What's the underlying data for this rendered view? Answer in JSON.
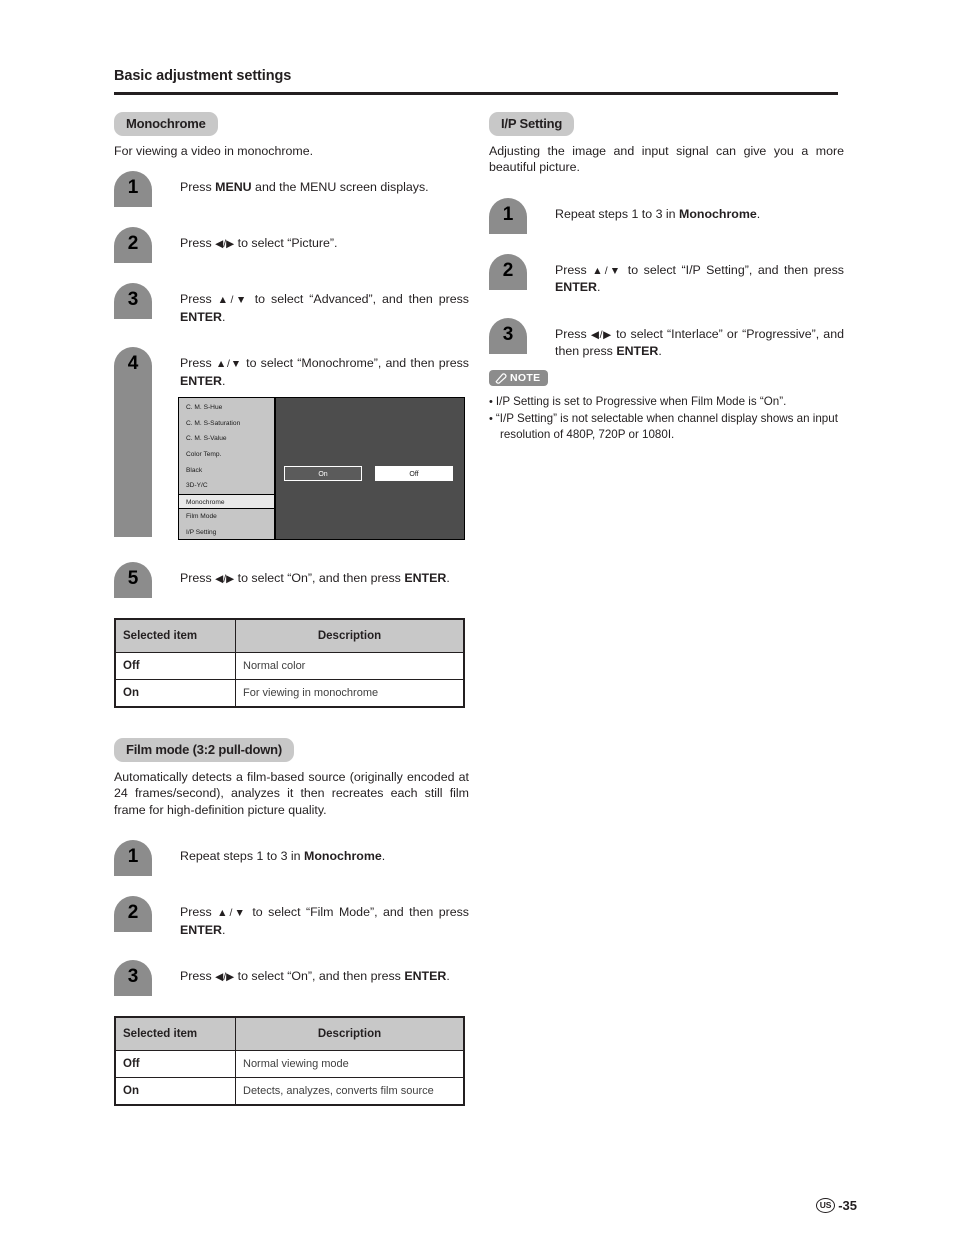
{
  "header": {
    "title": "Basic adjustment settings"
  },
  "left_column": {
    "monochrome": {
      "badge": "Monochrome",
      "description": "For viewing a video in monochrome.",
      "steps": [
        {
          "num": "1",
          "text_html": "Press <b>MENU</b> and the MENU screen displays."
        },
        {
          "num": "2",
          "text_html": "Press <span class=\"arrow\">◀/▶</span> to select “Picture”."
        },
        {
          "num": "3",
          "text_html": "Press <span class=\"arrow\">▲/▼</span> to select “Advanced”, and then press <b>ENTER</b>."
        },
        {
          "num": "4",
          "text_html": "Press <span class=\"arrow\">▲/▼</span> to select “Monochrome”, and then press <b>ENTER</b>."
        },
        {
          "num": "5",
          "text_html": "Press <span class=\"arrow\">◀/▶</span> to select “On”, and then press <b>ENTER</b>."
        }
      ],
      "osd": {
        "items": [
          "C. M. S-Hue",
          "C. M. S-Saturation",
          "C. M. S-Value",
          "Color Temp.",
          "Black",
          "3D-Y/C",
          "Monochrome",
          "Film Mode",
          "I/P Setting"
        ],
        "selected_item": "Monochrome",
        "button_on": "On",
        "button_off": "Off",
        "selected_button": "On"
      },
      "table": {
        "headers": [
          "Selected item",
          "Description"
        ],
        "rows": [
          [
            "Off",
            "Normal color"
          ],
          [
            "On",
            "For viewing in monochrome"
          ]
        ]
      }
    },
    "film_mode": {
      "badge": "Film mode (3:2 pull-down)",
      "description": "Automatically detects a film-based source (originally encoded at 24 frames/second), analyzes it then recreates each still film frame for high-definition picture quality.",
      "steps": [
        {
          "num": "1",
          "text_html": "Repeat steps 1 to 3 in <b>Monochrome</b>."
        },
        {
          "num": "2",
          "text_html": "Press <span class=\"arrow\">▲/▼</span> to select “Film Mode”, and then press <b>ENTER</b>."
        },
        {
          "num": "3",
          "text_html": "Press <span class=\"arrow\">◀/▶</span> to select “On”, and then press <b>ENTER</b>."
        }
      ],
      "table": {
        "headers": [
          "Selected item",
          "Description"
        ],
        "rows": [
          [
            "Off",
            "Normal viewing mode"
          ],
          [
            "On",
            "Detects, analyzes, converts film source"
          ]
        ]
      }
    }
  },
  "right_column": {
    "ip_setting": {
      "badge": "I/P Setting",
      "description": "Adjusting the image and input signal can give you a more beautiful picture.",
      "steps": [
        {
          "num": "1",
          "text_html": "Repeat steps 1 to 3 in <b>Monochrome</b>."
        },
        {
          "num": "2",
          "text_html": "Press <span class=\"arrow\">▲/▼</span> to select “I/P Setting”, and then press <b>ENTER</b>."
        },
        {
          "num": "3",
          "text_html": "Press <span class=\"arrow\">◀/▶</span> to select “Interlace” or “Progressive”, and then press <b>ENTER</b>."
        }
      ],
      "note": {
        "label": "NOTE",
        "items": [
          "I/P Setting is set to Progressive when Film Mode is “On”.",
          "“I/P Setting” is not selectable when channel display shows an input resolution of 480P, 720P or 1080I."
        ]
      }
    }
  },
  "footer": {
    "region": "US",
    "page": "-35"
  }
}
